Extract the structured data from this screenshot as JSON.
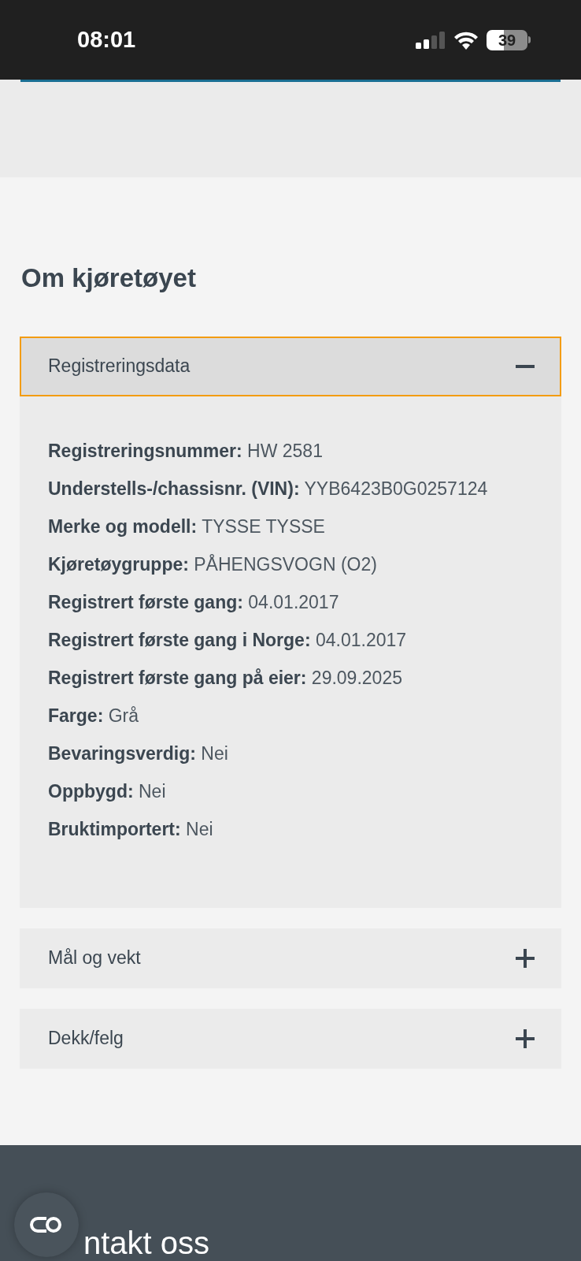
{
  "status_bar": {
    "time": "08:01",
    "battery": "39"
  },
  "section": {
    "title": "Om kjøretøyet"
  },
  "accordion": [
    {
      "title": "Registreringsdata",
      "expanded": true,
      "focused": true,
      "fields": [
        {
          "label": "Registreringsnummer:",
          "value": "HW 2581"
        },
        {
          "label": "Understells-/chassisnr. (VIN):",
          "value": "YYB6423B0G0257124"
        },
        {
          "label": "Merke og modell:",
          "value": "TYSSE TYSSE"
        },
        {
          "label": "Kjøretøygruppe:",
          "value": "PÅHENGSVOGN (O2)"
        },
        {
          "label": "Registrert første gang:",
          "value": "04.01.2017"
        },
        {
          "label": "Registrert første gang i Norge:",
          "value": "04.01.2017"
        },
        {
          "label": "Registrert første gang på eier:",
          "value": "29.09.2025"
        },
        {
          "label": "Farge:",
          "value": "Grå"
        },
        {
          "label": "Bevaringsverdig:",
          "value": "Nei"
        },
        {
          "label": "Oppbygd:",
          "value": "Nei"
        },
        {
          "label": "Bruktimportert:",
          "value": "Nei"
        }
      ]
    },
    {
      "title": "Mål og vekt",
      "expanded": false,
      "focused": false
    },
    {
      "title": "Dekk/felg",
      "expanded": false,
      "focused": false
    }
  ],
  "footer": {
    "title": "ntakt oss"
  }
}
